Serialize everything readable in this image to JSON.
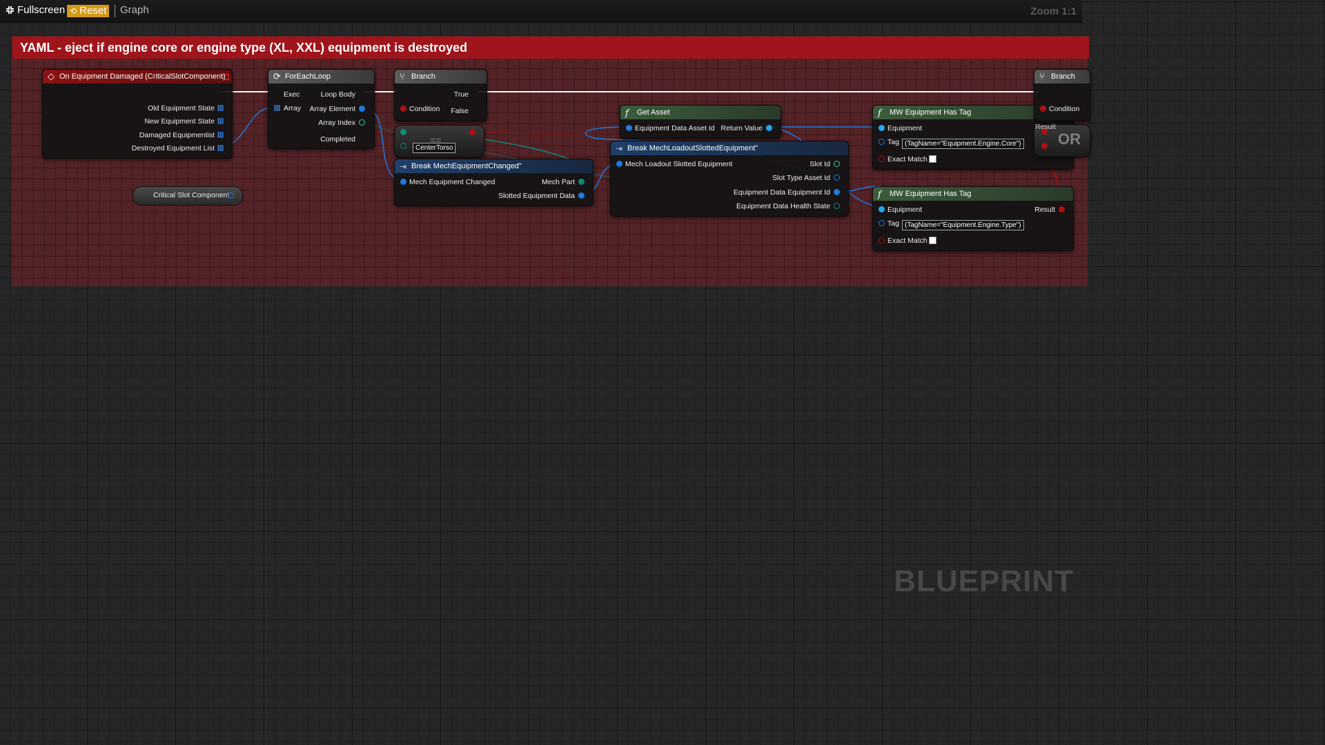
{
  "toolbar": {
    "fullscreen_label": "Fullscreen",
    "reset_label": "Reset",
    "graph_label": "Graph",
    "zoom_label": "Zoom 1:1"
  },
  "comment": {
    "title": "YAML - eject if engine core or engine type (XL, XXL) equipment is destroyed"
  },
  "nodes": {
    "event": {
      "title": "On Equipment Damaged (CriticalSlotComponent)",
      "pins": [
        "Old Equipment State",
        "New Equipment State",
        "Damaged Equipmentist",
        "Destroyed Equipment List"
      ]
    },
    "foreach": {
      "title": "ForEachLoop",
      "in_exec": "Exec",
      "in_array": "Array",
      "out_loop_body": "Loop Body",
      "out_element": "Array Element",
      "out_index": "Array Index",
      "out_completed": "Completed"
    },
    "branch1": {
      "title": "Branch",
      "condition": "Condition",
      "true": "True",
      "false": "False"
    },
    "equals": {
      "value": "CenterTorso",
      "symbol": "=="
    },
    "break_changed": {
      "title": "Break MechEquipmentChanged\"",
      "input": "Mech Equipment Changed",
      "out_part": "Mech Part",
      "out_slotted": "Slotted Equipment Data"
    },
    "get_asset": {
      "title": "Get Asset",
      "input": "Equipment Data Asset Id",
      "output": "Return Value"
    },
    "break_slotted": {
      "title": "Break MechLoadoutSlottedEquipment\"",
      "input": "Mech Loadout Slotted Equipment",
      "outputs": [
        "Slot Id",
        "Slot Type Asset Id",
        "Equipment Data Equipment Id",
        "Equipment Data Health State"
      ]
    },
    "has_tag1": {
      "title": "MW Equipment Has Tag",
      "equipment": "Equipment",
      "tag": "Tag",
      "tag_value": "(TagName=\"Equipment.Engine.Core\")",
      "exact_match": "Exact Match",
      "result": "Result"
    },
    "has_tag2": {
      "title": "MW Equipment Has Tag",
      "equipment": "Equipment",
      "tag": "Tag",
      "tag_value": "(TagName=\"Equipment.Engine.Type\")",
      "exact_match": "Exact Match",
      "result": "Result"
    },
    "branch2": {
      "title": "Branch",
      "condition": "Condition"
    },
    "or_node": {
      "label": "OR"
    },
    "variable": {
      "label": "Critical Slot Component"
    }
  },
  "watermark": "BLUEPRINT",
  "colors": {
    "comment_header": "#a0141b",
    "reset_button": "#d39a16",
    "object_pin": "#1f7ae0",
    "struct_pin": "#0f8a7a",
    "bool_pin": "#b01010",
    "exec_pin": "#ffffff"
  }
}
